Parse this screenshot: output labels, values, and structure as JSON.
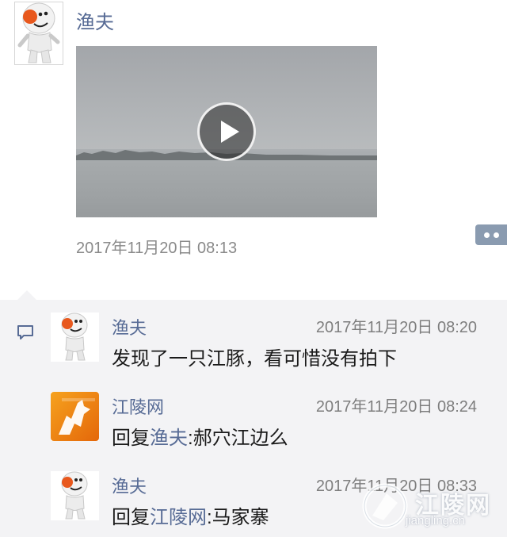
{
  "post": {
    "author": "渔夫",
    "time": "2017年11月20日 08:13",
    "avatar_icon": "snowman-avatar-icon"
  },
  "comments": [
    {
      "author": "渔夫",
      "time": "2017年11月20日 08:20",
      "text": "发现了一只江豚，看可惜没有拍下",
      "avatar_icon": "snowman-avatar-icon"
    },
    {
      "author": "江陵网",
      "time": "2017年11月20日 08:24",
      "reply_prefix": "回复",
      "reply_to": "渔夫",
      "text": ":郝穴江边么",
      "avatar_icon": "fox-logo-icon"
    },
    {
      "author": "渔夫",
      "time": "2017年11月20日 08:33",
      "reply_prefix": "回复",
      "reply_to": "江陵网",
      "text": ":马家寨",
      "avatar_icon": "snowman-avatar-icon"
    }
  ],
  "watermark": {
    "brand": "江陵网",
    "url": "jiangling.cn"
  },
  "colors": {
    "name": "#576b95",
    "time": "#8a8a8a",
    "panel": "#f3f3f5",
    "more_button": "#8a9bb0",
    "fox_orange": "#f08a10"
  }
}
